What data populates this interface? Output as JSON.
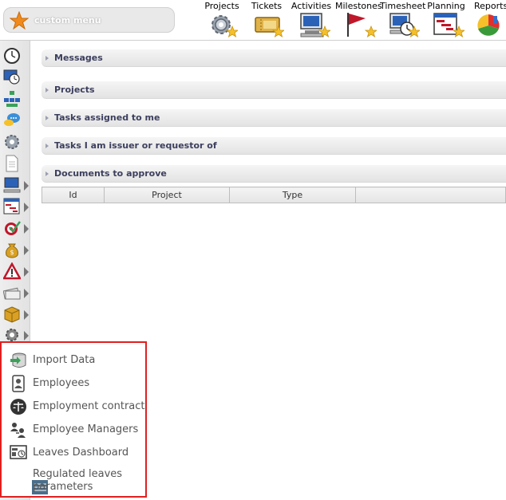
{
  "custom_menu": {
    "label": "custom menu"
  },
  "topmenu": [
    {
      "label": "Projects"
    },
    {
      "label": "Tickets"
    },
    {
      "label": "Activities"
    },
    {
      "label": "Milestones"
    },
    {
      "label": "Timesheet"
    },
    {
      "label": "Planning"
    },
    {
      "label": "Reports"
    }
  ],
  "sections": [
    {
      "title": "Messages"
    },
    {
      "title": "Projects"
    },
    {
      "title": "Tasks assigned to me"
    },
    {
      "title": "Tasks I am issuer or requestor of"
    },
    {
      "title": "Documents to approve"
    }
  ],
  "documents_table": {
    "columns": [
      "Id",
      "Project",
      "Type",
      ""
    ]
  },
  "submenu": {
    "items": [
      {
        "label": "Import Data",
        "icon": "import-data-icon"
      },
      {
        "label": "Employees",
        "icon": "employees-icon"
      },
      {
        "label": "Employment contract",
        "icon": "employment-contract-icon"
      },
      {
        "label": "Employee Managers",
        "icon": "employee-managers-icon"
      },
      {
        "label": "Leaves Dashboard",
        "icon": "leaves-dashboard-icon"
      },
      {
        "label": "Regulated leaves parameters",
        "icon": "regulated-leaves-icon"
      }
    ]
  },
  "colors": {
    "highlight_border": "#e02020",
    "section_title": "#3c3f5e",
    "menu_star": "#f08a1c"
  }
}
